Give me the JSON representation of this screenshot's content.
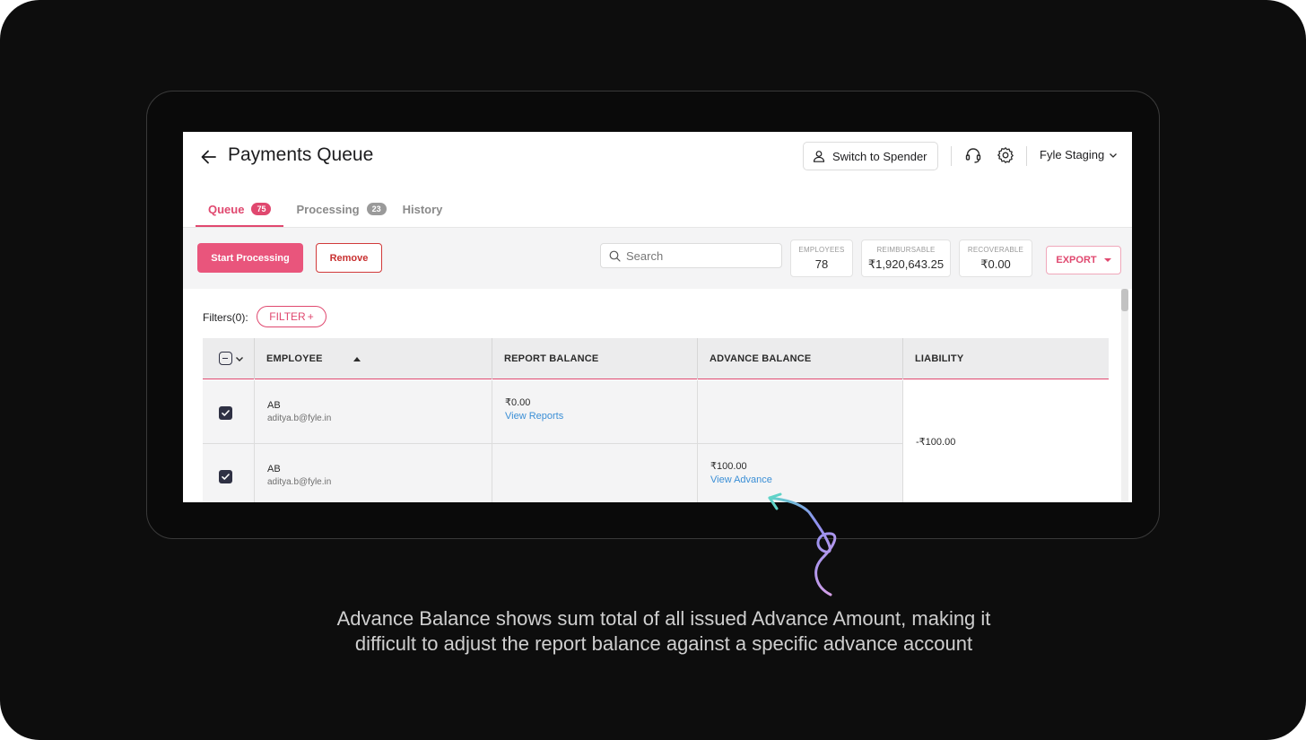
{
  "header": {
    "title": "Payments Queue",
    "switch_button": "Switch to Spender",
    "org_name": "Fyle Staging"
  },
  "tabs": [
    {
      "label": "Queue",
      "count": "75",
      "active": true
    },
    {
      "label": "Processing",
      "count": "23",
      "active": false
    },
    {
      "label": "History",
      "count": "",
      "active": false
    }
  ],
  "toolbar": {
    "start_processing": "Start Processing",
    "remove": "Remove",
    "search_placeholder": "Search",
    "stats": [
      {
        "label": "EMPLOYEES",
        "value": "78"
      },
      {
        "label": "REIMBURSABLE",
        "value": "₹1,920,643.25"
      },
      {
        "label": "RECOVERABLE",
        "value": "₹0.00"
      }
    ],
    "export": "EXPORT"
  },
  "filters": {
    "label": "Filters(0):",
    "button": "FILTER",
    "plus": "+"
  },
  "table": {
    "columns": [
      "EMPLOYEE",
      "REPORT BALANCE",
      "ADVANCE BALANCE",
      "LIABILITY"
    ],
    "rows": [
      {
        "checked": true,
        "name": "AB",
        "email": "aditya.b@fyle.in",
        "report_balance": "₹0.00",
        "report_link": "View Reports",
        "advance_balance": "",
        "advance_link": ""
      },
      {
        "checked": true,
        "name": "AB",
        "email": "aditya.b@fyle.in",
        "report_balance": "",
        "report_link": "",
        "advance_balance": "₹100.00",
        "advance_link": "View Advance"
      }
    ],
    "liability": "-₹100.00"
  },
  "caption": {
    "line1": "Advance Balance shows sum total of all issued Advance Amount, making it",
    "line2": "difficult to adjust the report balance against a specific advance account"
  },
  "colors": {
    "accent": "#e0486f",
    "primary_button": "#e9557c",
    "link": "#3b8fd6",
    "background": "#0d0d0d"
  }
}
